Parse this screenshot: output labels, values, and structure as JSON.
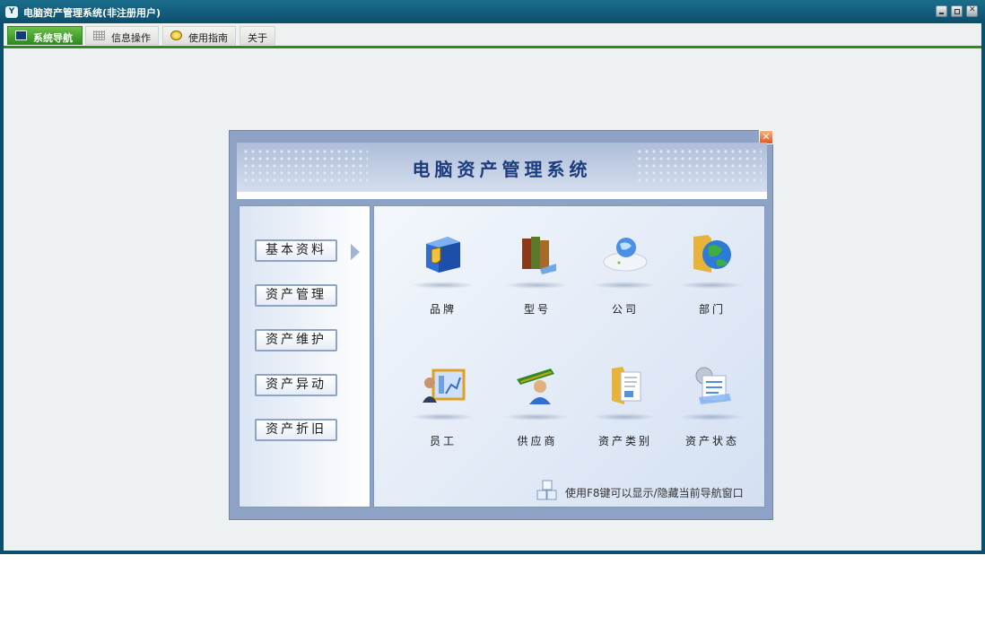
{
  "window": {
    "title": "电脑资产管理系统(非注册用户)",
    "icon_text": "Y"
  },
  "tabs": [
    {
      "label": "系统导航",
      "icon": "monitor-icon",
      "active": true
    },
    {
      "label": "信息操作",
      "icon": "grid-icon",
      "active": false
    },
    {
      "label": "使用指南",
      "icon": "guide-icon",
      "active": false
    },
    {
      "label": "关于",
      "icon": "",
      "active": false
    }
  ],
  "nav": {
    "close_glyph": "✕",
    "banner_title": "电脑资产管理系统",
    "menu": [
      {
        "label": "基本资料",
        "selected": true
      },
      {
        "label": "资产管理",
        "selected": false
      },
      {
        "label": "资产维护",
        "selected": false
      },
      {
        "label": "资产异动",
        "selected": false
      },
      {
        "label": "资产折旧",
        "selected": false
      }
    ],
    "tiles": [
      {
        "label": "品牌",
        "icon": "brand-shield-icon"
      },
      {
        "label": "型号",
        "icon": "model-books-icon"
      },
      {
        "label": "公司",
        "icon": "company-globe-icon"
      },
      {
        "label": "部门",
        "icon": "department-folder-icon"
      },
      {
        "label": "员工",
        "icon": "employee-icon"
      },
      {
        "label": "供应商",
        "icon": "supplier-icon"
      },
      {
        "label": "资产类别",
        "icon": "asset-category-icon"
      },
      {
        "label": "资产状态",
        "icon": "asset-status-icon"
      }
    ],
    "hint": "使用F8键可以显示/隐藏当前导航窗口"
  },
  "colors": {
    "titlebar": "#0b4f6c",
    "active_tab": "#2f8a20",
    "banner_text": "#1c3c7d",
    "panel_frame": "#8da2c4"
  }
}
